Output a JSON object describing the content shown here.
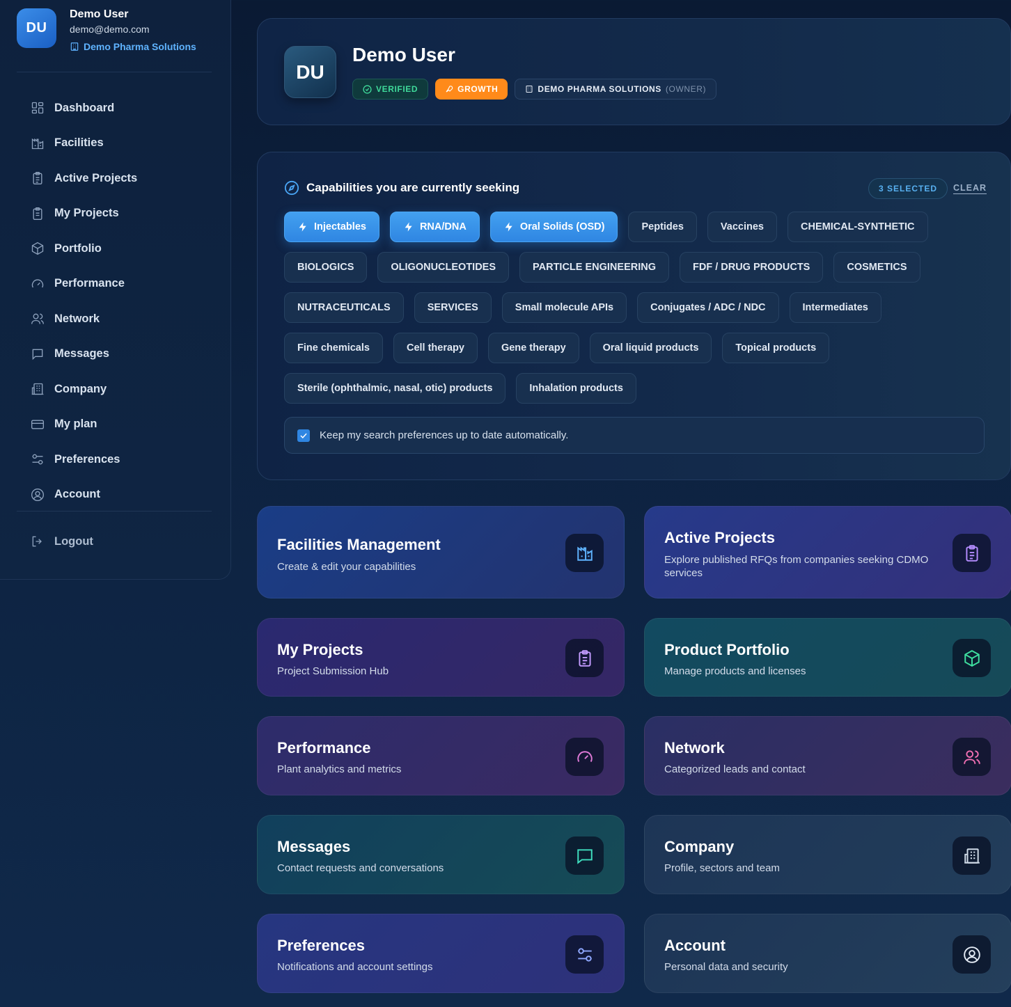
{
  "sidebar": {
    "avatar_initials": "DU",
    "user_name": "Demo User",
    "user_email": "demo@demo.com",
    "company": "Demo Pharma Solutions",
    "items": [
      {
        "label": "Dashboard",
        "icon": "dashboard-icon"
      },
      {
        "label": "Facilities",
        "icon": "factory-icon"
      },
      {
        "label": "Active Projects",
        "icon": "clipboard-icon"
      },
      {
        "label": "My Projects",
        "icon": "clipboard-icon"
      },
      {
        "label": "Portfolio",
        "icon": "box-icon"
      },
      {
        "label": "Performance",
        "icon": "gauge-icon"
      },
      {
        "label": "Network",
        "icon": "users-icon"
      },
      {
        "label": "Messages",
        "icon": "message-icon"
      },
      {
        "label": "Company",
        "icon": "building-icon"
      },
      {
        "label": "My plan",
        "icon": "credit-card-icon"
      },
      {
        "label": "Preferences",
        "icon": "sliders-icon"
      },
      {
        "label": "Account",
        "icon": "user-circle-icon"
      }
    ],
    "logout_label": "Logout"
  },
  "header": {
    "avatar_initials": "DU",
    "name": "Demo User",
    "verified_label": "VERIFIED",
    "plan_label": "GROWTH",
    "company_label": "DEMO PHARMA SOLUTIONS",
    "role_label": "(OWNER)"
  },
  "capabilities": {
    "title": "Capabilities you are currently seeking",
    "selected_label": "3 SELECTED",
    "clear_label": "CLEAR",
    "chips": [
      {
        "label": "Injectables",
        "selected": true
      },
      {
        "label": "RNA/DNA",
        "selected": true
      },
      {
        "label": "Oral Solids (OSD)",
        "selected": true
      },
      {
        "label": "Peptides",
        "selected": false
      },
      {
        "label": "Vaccines",
        "selected": false
      },
      {
        "label": "CHEMICAL-SYNTHETIC",
        "selected": false
      },
      {
        "label": "BIOLOGICS",
        "selected": false
      },
      {
        "label": "OLIGONUCLEOTIDES",
        "selected": false
      },
      {
        "label": "PARTICLE ENGINEERING",
        "selected": false
      },
      {
        "label": "FDF / DRUG PRODUCTS",
        "selected": false
      },
      {
        "label": "COSMETICS",
        "selected": false
      },
      {
        "label": "NUTRACEUTICALS",
        "selected": false
      },
      {
        "label": "SERVICES",
        "selected": false
      },
      {
        "label": "Small molecule APIs",
        "selected": false
      },
      {
        "label": "Conjugates / ADC / NDC",
        "selected": false
      },
      {
        "label": "Intermediates",
        "selected": false
      },
      {
        "label": "Fine chemicals",
        "selected": false
      },
      {
        "label": "Cell therapy",
        "selected": false
      },
      {
        "label": "Gene therapy",
        "selected": false
      },
      {
        "label": "Oral liquid products",
        "selected": false
      },
      {
        "label": "Topical products",
        "selected": false
      },
      {
        "label": "Sterile (ophthalmic, nasal, otic) products",
        "selected": false
      },
      {
        "label": "Inhalation products",
        "selected": false
      }
    ],
    "keep_updated_label": "Keep my search preferences up to date automatically.",
    "keep_updated_checked": true
  },
  "tiles": [
    {
      "title": "Facilities Management",
      "subtitle": "Create & edit your capabilities",
      "icon": "factory-icon",
      "accent": "#5fb3ff"
    },
    {
      "title": "Active Projects",
      "subtitle": "Explore published RFQs from companies seeking CDMO services",
      "icon": "clipboard-icon",
      "accent": "#b48cff"
    },
    {
      "title": "My Projects",
      "subtitle": "Project Submission Hub",
      "icon": "clipboard-icon",
      "accent": "#c39bff"
    },
    {
      "title": "Product Portfolio",
      "subtitle": "Manage products and licenses",
      "icon": "box-icon",
      "accent": "#3fe0a0"
    },
    {
      "title": "Performance",
      "subtitle": "Plant analytics and metrics",
      "icon": "gauge-icon",
      "accent": "#e07ad8"
    },
    {
      "title": "Network",
      "subtitle": "Categorized leads and contact",
      "icon": "users-icon",
      "accent": "#f06fb3"
    },
    {
      "title": "Messages",
      "subtitle": "Contact requests and conversations",
      "icon": "message-icon",
      "accent": "#3fe0c0"
    },
    {
      "title": "Company",
      "subtitle": "Profile, sectors and team",
      "icon": "building-icon",
      "accent": "#d0dbe8"
    },
    {
      "title": "Preferences",
      "subtitle": "Notifications and account settings",
      "icon": "sliders-icon",
      "accent": "#8fa8ff"
    },
    {
      "title": "Account",
      "subtitle": "Personal data and security",
      "icon": "user-circle-icon",
      "accent": "#e2e9f3"
    }
  ],
  "colors": {
    "background": "#0b1d38",
    "accent_blue": "#2f86e2",
    "verified_green": "#3fd99a",
    "growth_orange": "#ff8a1a"
  }
}
